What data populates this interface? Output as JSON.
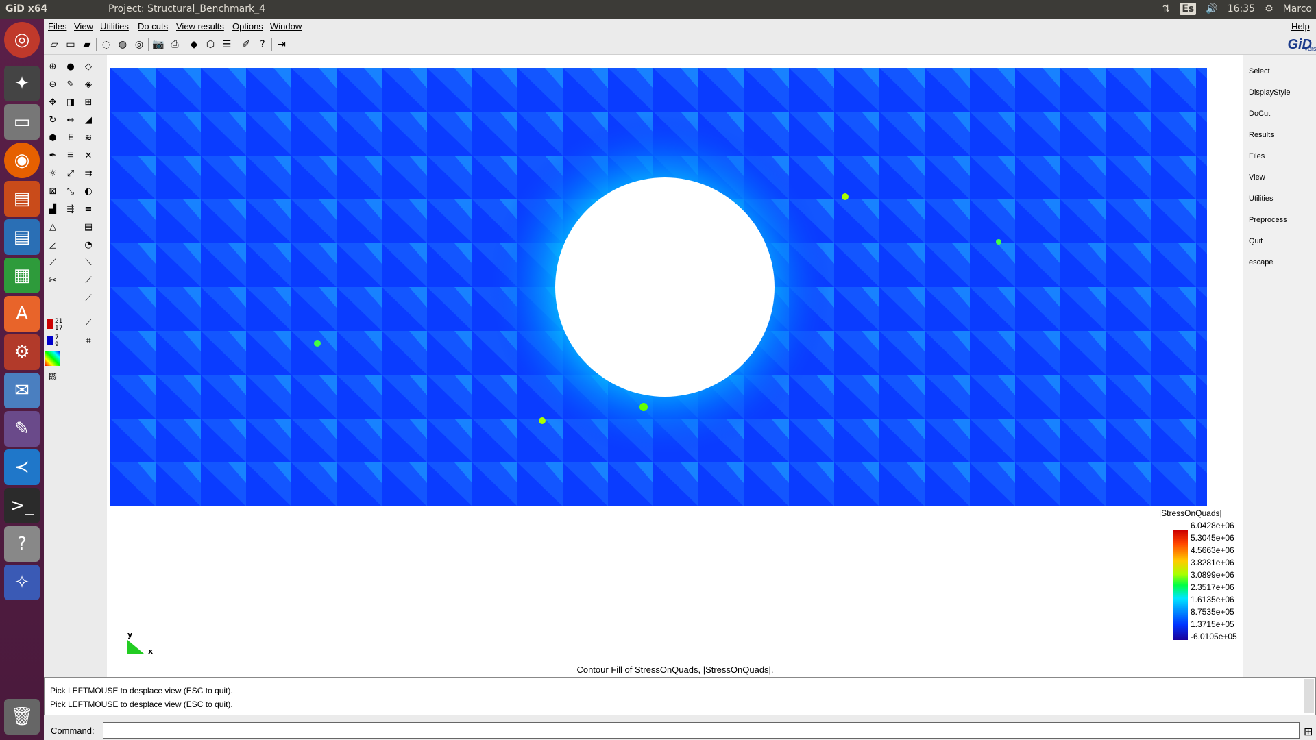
{
  "topbar": {
    "app_name": "GiD x64",
    "window_title": "Project: Structural_Benchmark_4",
    "keyboard_layout": "Es",
    "clock": "16:35",
    "user": "Marco"
  },
  "menubar": {
    "items": [
      "Files",
      "View",
      "Utilities",
      "Do cuts",
      "View results",
      "Options",
      "Window"
    ],
    "help": "Help"
  },
  "logo": {
    "brand": "GiD",
    "version": "Version 9"
  },
  "right_menu": [
    "Select",
    "DisplayStyle",
    "DoCut",
    "Results",
    "Files",
    "View",
    "Utilities",
    "Preprocess",
    "Quit",
    "escape"
  ],
  "left_tools_labels": [
    "21",
    "17",
    "7",
    "9"
  ],
  "legend": {
    "title": "|StressOnQuads|",
    "values": [
      "6.0428e+06",
      "5.3045e+06",
      "4.5663e+06",
      "3.8281e+06",
      "3.0899e+06",
      "2.3517e+06",
      "1.6135e+06",
      "8.7535e+05",
      "1.3715e+05",
      "-6.0105e+05"
    ]
  },
  "axes": {
    "y": "y",
    "x": "x"
  },
  "caption": "Contour Fill of StressOnQuads, |StressOnQuads|.",
  "console": {
    "lines": [
      "Pick LEFTMOUSE to desplace view (ESC to quit).",
      "Pick LEFTMOUSE to desplace view (ESC to quit)."
    ]
  },
  "command": {
    "label": "Command:",
    "value": ""
  },
  "colors": {
    "plot_base": "#0a3cff",
    "hole": "#ffffff",
    "launcher": "#5a1f48",
    "topbar": "#3c3b37"
  }
}
